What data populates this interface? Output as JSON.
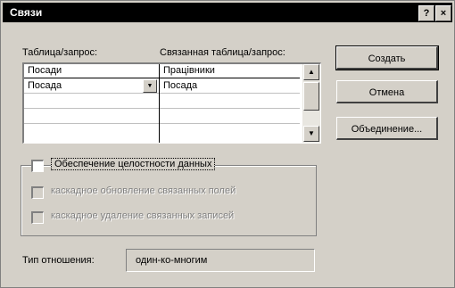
{
  "window": {
    "title": "Связи",
    "help_btn": "?",
    "close_btn": "×"
  },
  "labels": {
    "table_query": "Таблица/запрос:",
    "related_table_query": "Связанная таблица/запрос:"
  },
  "grid": {
    "left_header": "Посади",
    "right_header": "Працівники",
    "row1_left": "Посада",
    "row1_right": "Посада"
  },
  "buttons": {
    "create": "Создать",
    "cancel": "Отмена",
    "join": "Объединение..."
  },
  "integrity": {
    "enforce": "Обеспечение целостности данных",
    "cascade_update": "каскадное обновление связанных полей",
    "cascade_delete": "каскадное удаление связанных записей"
  },
  "relation": {
    "label": "Тип отношения:",
    "value": "один-ко-многим"
  }
}
